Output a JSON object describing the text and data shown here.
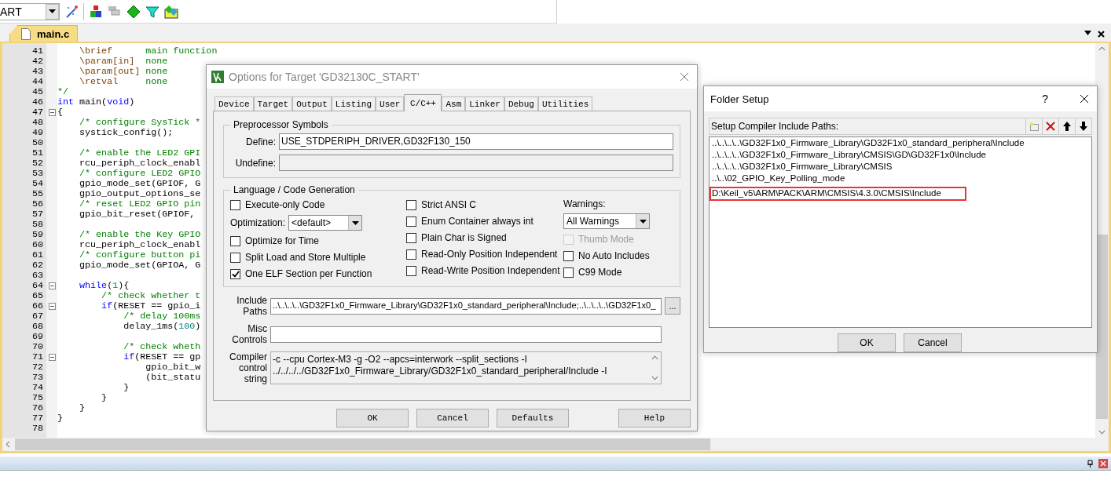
{
  "toolbar": {
    "target": "ART"
  },
  "editor": {
    "tabs": [
      {
        "label": "main.c",
        "selected": true
      }
    ],
    "lines": [
      {
        "number": "41",
        "parts": [
          {
            "kind": "doc",
            "text": "    \\brief"
          },
          {
            "kind": "comment",
            "text": "      main function"
          }
        ]
      },
      {
        "number": "42",
        "parts": [
          {
            "kind": "doc",
            "text": "    \\param[in]"
          },
          {
            "kind": "comment",
            "text": "  none"
          }
        ]
      },
      {
        "number": "43",
        "parts": [
          {
            "kind": "doc",
            "text": "    \\param[out]"
          },
          {
            "kind": "comment",
            "text": " none"
          }
        ]
      },
      {
        "number": "44",
        "parts": [
          {
            "kind": "doc",
            "text": "    \\retval"
          },
          {
            "kind": "comment",
            "text": "     none"
          }
        ]
      },
      {
        "number": "45",
        "parts": [
          {
            "kind": "comment",
            "text": "*/"
          }
        ]
      },
      {
        "number": "46",
        "parts": [
          {
            "kind": "keyword",
            "text": "int"
          },
          {
            "kind": "plain",
            "text": " main("
          },
          {
            "kind": "keyword",
            "text": "void"
          },
          {
            "kind": "plain",
            "text": ")"
          }
        ]
      },
      {
        "number": "47",
        "fold": true,
        "parts": [
          {
            "kind": "plain",
            "text": "{"
          }
        ]
      },
      {
        "number": "48",
        "parts": [
          {
            "kind": "comment",
            "text": "    /* configure SysTick *"
          }
        ]
      },
      {
        "number": "49",
        "parts": [
          {
            "kind": "plain",
            "text": "    systick_config();"
          }
        ]
      },
      {
        "number": "50"
      },
      {
        "number": "51",
        "parts": [
          {
            "kind": "comment",
            "text": "    /* enable the LED2 GPI"
          }
        ]
      },
      {
        "number": "52",
        "parts": [
          {
            "kind": "plain",
            "text": "    rcu_periph_clock_enabl"
          }
        ]
      },
      {
        "number": "53",
        "parts": [
          {
            "kind": "comment",
            "text": "    /* configure LED2 GPIO"
          }
        ]
      },
      {
        "number": "54",
        "parts": [
          {
            "kind": "plain",
            "text": "    gpio_mode_set(GPIOF, G"
          }
        ]
      },
      {
        "number": "55",
        "parts": [
          {
            "kind": "plain",
            "text": "    gpio_output_options_se"
          }
        ]
      },
      {
        "number": "56",
        "parts": [
          {
            "kind": "comment",
            "text": "    /* reset LED2 GPIO pin"
          }
        ]
      },
      {
        "number": "57",
        "parts": [
          {
            "kind": "plain",
            "text": "    gpio_bit_reset(GPIOF,"
          }
        ]
      },
      {
        "number": "58"
      },
      {
        "number": "59",
        "parts": [
          {
            "kind": "comment",
            "text": "    /* enable the Key GPIO"
          }
        ]
      },
      {
        "number": "60",
        "parts": [
          {
            "kind": "plain",
            "text": "    rcu_periph_clock_enabl"
          }
        ]
      },
      {
        "number": "61",
        "parts": [
          {
            "kind": "comment",
            "text": "    /* configure button pi"
          }
        ]
      },
      {
        "number": "62",
        "parts": [
          {
            "kind": "plain",
            "text": "    gpio_mode_set(GPIOA, G"
          }
        ]
      },
      {
        "number": "63"
      },
      {
        "number": "64",
        "fold": true,
        "parts": [
          {
            "kind": "keyword",
            "text": "    while"
          },
          {
            "kind": "plain",
            "text": "("
          },
          {
            "kind": "number",
            "text": "1"
          },
          {
            "kind": "plain",
            "text": "){"
          }
        ]
      },
      {
        "number": "65",
        "parts": [
          {
            "kind": "comment",
            "text": "        /* check whether t"
          }
        ]
      },
      {
        "number": "66",
        "fold": true,
        "parts": [
          {
            "kind": "keyword",
            "text": "        if"
          },
          {
            "kind": "plain",
            "text": "(RESET == gpio_i"
          }
        ]
      },
      {
        "number": "67",
        "parts": [
          {
            "kind": "comment",
            "text": "            /* delay 100ms"
          }
        ]
      },
      {
        "number": "68",
        "parts": [
          {
            "kind": "plain",
            "text": "            delay_1ms("
          },
          {
            "kind": "number",
            "text": "100"
          },
          {
            "kind": "plain",
            "text": ")"
          }
        ]
      },
      {
        "number": "69"
      },
      {
        "number": "70",
        "parts": [
          {
            "kind": "comment",
            "text": "            /* check wheth"
          }
        ]
      },
      {
        "number": "71",
        "fold": true,
        "parts": [
          {
            "kind": "keyword",
            "text": "            if"
          },
          {
            "kind": "plain",
            "text": "(RESET == gp"
          }
        ]
      },
      {
        "number": "72",
        "parts": [
          {
            "kind": "plain",
            "text": "                gpio_bit_w"
          }
        ]
      },
      {
        "number": "73",
        "parts": [
          {
            "kind": "plain",
            "text": "                (bit_statu"
          }
        ]
      },
      {
        "number": "74",
        "parts": [
          {
            "kind": "plain",
            "text": "            }"
          }
        ]
      },
      {
        "number": "75",
        "parts": [
          {
            "kind": "plain",
            "text": "        }"
          }
        ]
      },
      {
        "number": "76",
        "parts": [
          {
            "kind": "plain",
            "text": "    }"
          }
        ]
      },
      {
        "number": "77",
        "parts": [
          {
            "kind": "plain",
            "text": "}"
          }
        ]
      },
      {
        "number": "78"
      }
    ]
  },
  "options_dialog": {
    "title": "Options for Target 'GD32130C_START'",
    "tabs": [
      {
        "label": "Device",
        "selected": false
      },
      {
        "label": "Target",
        "selected": false
      },
      {
        "label": "Output",
        "selected": false
      },
      {
        "label": "Listing",
        "selected": false
      },
      {
        "label": "User",
        "selected": false
      },
      {
        "label": "C/C++",
        "selected": true
      },
      {
        "label": "Asm",
        "selected": false
      },
      {
        "label": "Linker",
        "selected": false
      },
      {
        "label": "Debug",
        "selected": false
      },
      {
        "label": "Utilities",
        "selected": false
      }
    ],
    "preprocessor": {
      "title": "Preprocessor Symbols",
      "define_label": "Define:",
      "define_value": "USE_STDPERIPH_DRIVER,GD32F130_150",
      "undefine_label": "Undefine:"
    },
    "language": {
      "title": "Language / Code Generation",
      "column_1": [
        {
          "kind": "checkbox",
          "label": "Execute-only Code",
          "checked": false,
          "disabled": false
        },
        {
          "kind": "select",
          "label": "Optimization:",
          "value": "<default>"
        },
        {
          "kind": "checkbox",
          "label": "Optimize for Time",
          "checked": false,
          "disabled": false
        },
        {
          "kind": "checkbox",
          "label": "Split Load and Store Multiple",
          "checked": false,
          "disabled": false
        },
        {
          "kind": "checkbox",
          "label": "One ELF Section per Function",
          "checked": true,
          "disabled": false
        }
      ],
      "column_2": [
        {
          "kind": "checkbox",
          "label": "Strict ANSI C",
          "checked": false,
          "disabled": false
        },
        {
          "kind": "checkbox",
          "label": "Enum Container always int",
          "checked": false,
          "disabled": false
        },
        {
          "kind": "checkbox",
          "label": "Plain Char is Signed",
          "checked": false,
          "disabled": false
        },
        {
          "kind": "checkbox",
          "label": "Read-Only Position Independent",
          "checked": false,
          "disabled": false
        },
        {
          "kind": "checkbox",
          "label": "Read-Write Position Independent",
          "checked": false,
          "disabled": false
        }
      ],
      "warnings_label": "Warnings:",
      "warnings_value": "All Warnings",
      "column_3": [
        {
          "kind": "checkbox",
          "label": "Thumb Mode",
          "checked": false,
          "disabled": true
        },
        {
          "kind": "checkbox",
          "label": "No Auto Includes",
          "checked": false,
          "disabled": false
        },
        {
          "kind": "checkbox",
          "label": "C99 Mode",
          "checked": false,
          "disabled": false
        }
      ]
    },
    "include_label": "Include Paths",
    "include_value": "..\\..\\..\\..\\GD32F1x0_Firmware_Library\\GD32F1x0_standard_peripheral\\Include;..\\..\\..\\..\\GD32F1x0_",
    "browse": "...",
    "misc_label": "Misc Controls",
    "compiler_label": "Compiler control string",
    "compiler_lines": [
      "-c --cpu Cortex-M3 -g -O2 --apcs=interwork --split_sections -I",
      "../../../../GD32F1x0_Firmware_Library/GD32F1x0_standard_peripheral/Include -I"
    ],
    "buttons": [
      "OK",
      "Cancel",
      "Defaults",
      "Help"
    ]
  },
  "folder_setup": {
    "title": "Folder Setup",
    "help": "?",
    "label": "Setup Compiler Include Paths:",
    "paths": [
      {
        "text": "..\\..\\..\\..\\GD32F1x0_Firmware_Library\\GD32F1x0_standard_peripheral\\Include",
        "highlighted": false
      },
      {
        "text": "..\\..\\..\\..\\GD32F1x0_Firmware_Library\\CMSIS\\GD\\GD32F1x0\\Include",
        "highlighted": false
      },
      {
        "text": "..\\..\\..\\..\\GD32F1x0_Firmware_Library\\CMSIS",
        "highlighted": false
      },
      {
        "text": "..\\..\\02_GPIO_Key_Polling_mode",
        "highlighted": false
      },
      {
        "text": "D:\\Keil_v5\\ARM\\PACK\\ARM\\CMSIS\\4.3.0\\CMSIS\\Include",
        "highlighted": true
      }
    ],
    "buttons": [
      "OK",
      "Cancel"
    ]
  }
}
